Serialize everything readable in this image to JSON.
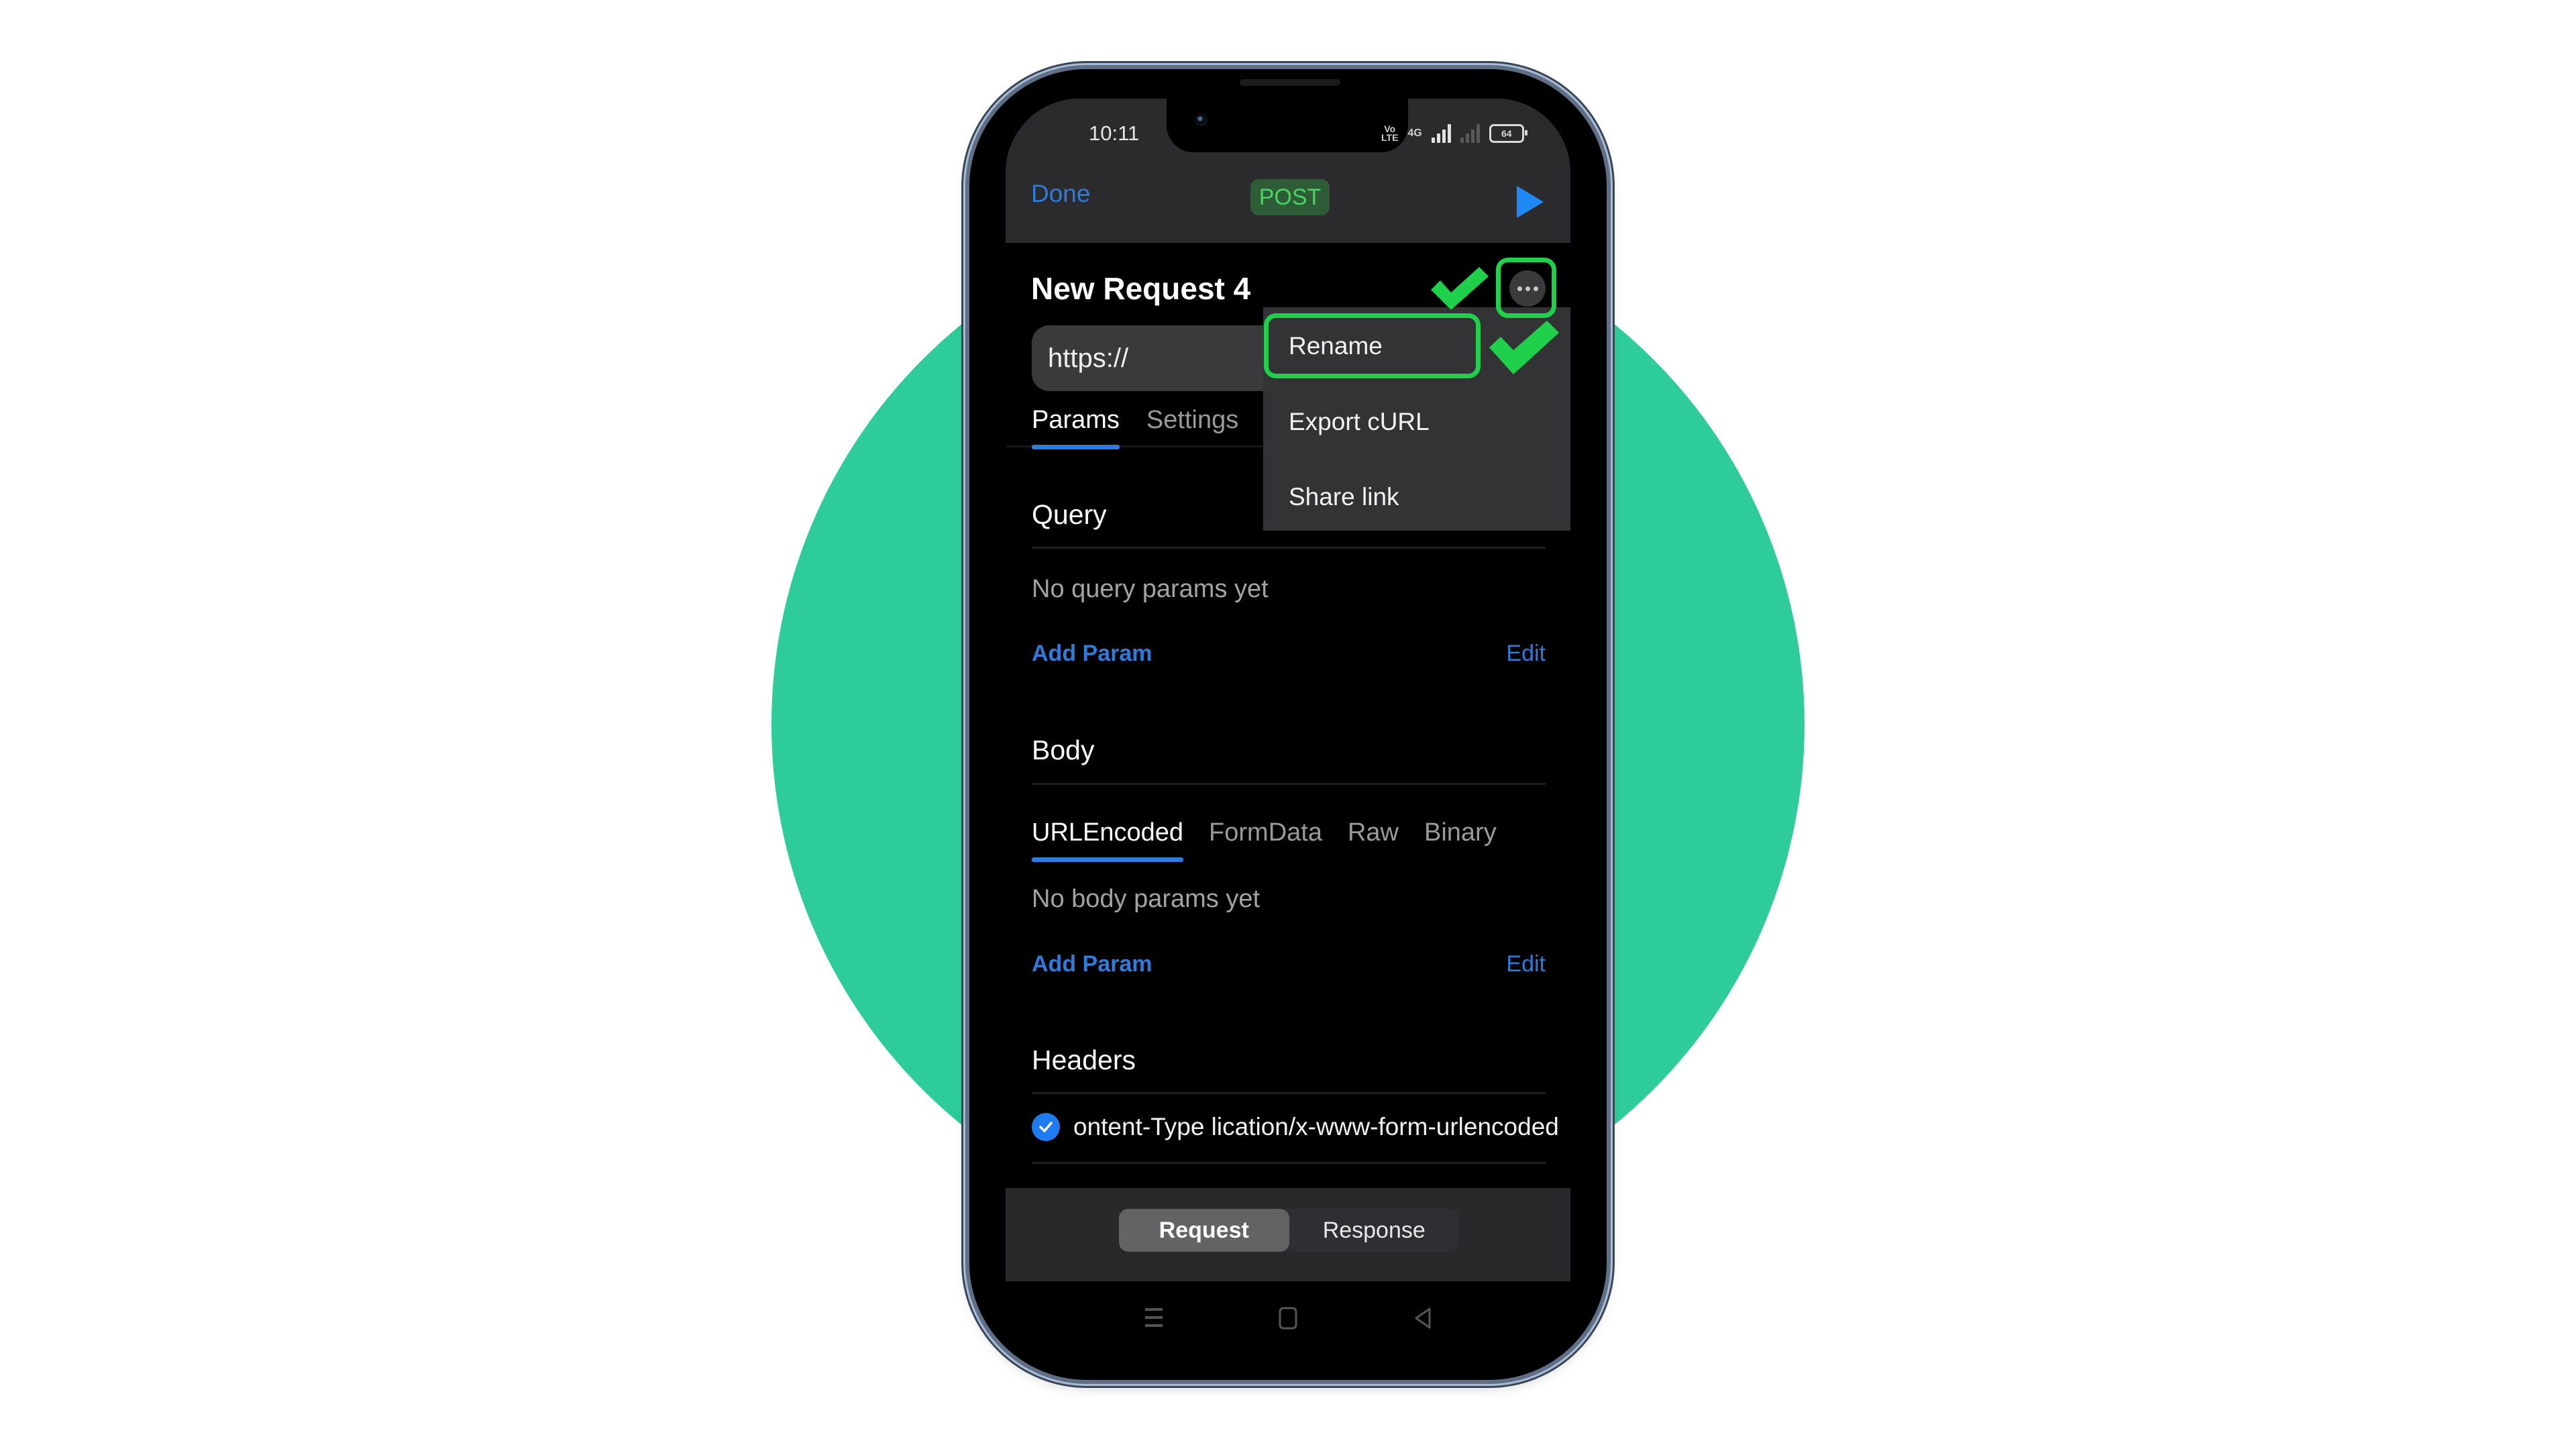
{
  "status_bar": {
    "time": "10:11",
    "network": "VoLTE",
    "network_sub": "4G",
    "battery": "64"
  },
  "header": {
    "done_label": "Done",
    "method": "POST",
    "send_icon": "play-icon"
  },
  "request": {
    "title": "New Request 4",
    "url_value": "https://",
    "more_icon": "ellipsis-icon"
  },
  "main_tabs": [
    {
      "label": "Params",
      "active": true
    },
    {
      "label": "Settings",
      "active": false
    }
  ],
  "menu": {
    "items": [
      {
        "label": "Rename",
        "highlighted": true
      },
      {
        "label": "Export cURL",
        "highlighted": false
      },
      {
        "label": "Share link",
        "highlighted": false
      }
    ]
  },
  "query": {
    "title": "Query",
    "empty_text": "No query params yet",
    "add_label": "Add Param",
    "edit_label": "Edit"
  },
  "body": {
    "title": "Body",
    "tabs": [
      {
        "label": "URLEncoded",
        "active": true
      },
      {
        "label": "FormData",
        "active": false
      },
      {
        "label": "Raw",
        "active": false
      },
      {
        "label": "Binary",
        "active": false
      }
    ],
    "empty_text": "No body params yet",
    "add_label": "Add Param",
    "edit_label": "Edit"
  },
  "headers": {
    "title": "Headers",
    "rows": [
      {
        "checked": true,
        "text": "ontent-Type lication/x-www-form-urlencoded"
      }
    ]
  },
  "bottom": {
    "segments": [
      {
        "label": "Request",
        "active": true
      },
      {
        "label": "Response",
        "active": false
      }
    ]
  },
  "colors": {
    "accent_blue": "#2f7bdc",
    "annotation_green": "#1fd14a",
    "background_circle": "#2ecc9a",
    "post_badge_text": "#47d35f"
  }
}
